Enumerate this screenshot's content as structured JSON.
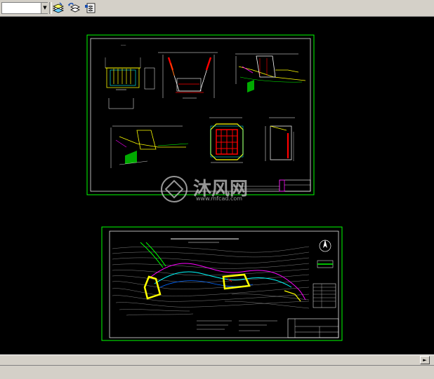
{
  "toolbar": {
    "layer_value": "",
    "icons": [
      "layer-properties-icon",
      "layer-previous-icon",
      "layer-states-icon"
    ]
  },
  "watermark": {
    "brand": "沐风网",
    "url": "www.mfcad.com"
  },
  "drawing_sheet_1": {
    "description_icon": "cad-section-sheet"
  },
  "drawing_sheet_2": {
    "description_icon": "cad-site-plan-sheet"
  },
  "colors": {
    "background": "#000000",
    "sheet_border": "#00ff00",
    "inner_border": "#ffffff",
    "accent_yellow": "#ffff00",
    "accent_red": "#ff0000",
    "accent_magenta": "#ff00ff",
    "accent_cyan": "#00ffff",
    "ui_gray": "#d4d0c8"
  }
}
